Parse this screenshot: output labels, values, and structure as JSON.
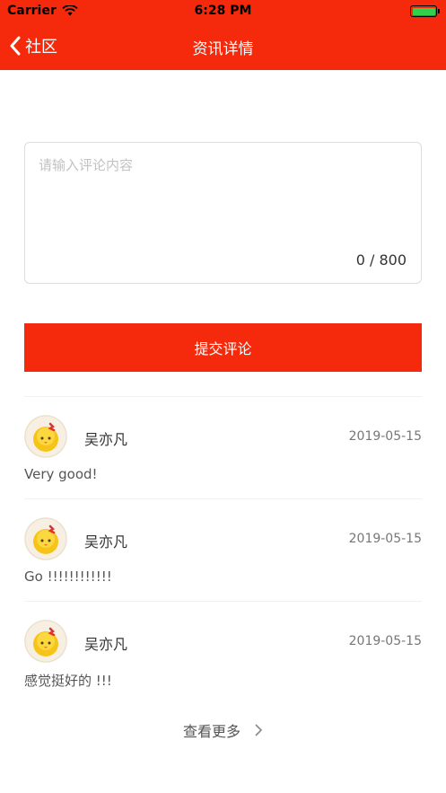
{
  "status_bar": {
    "carrier": "Carrier",
    "time": "6:28 PM",
    "wifi_icon": "wifi-icon",
    "battery_icon": "battery-icon",
    "battery_color": "#35d04a"
  },
  "nav": {
    "back_label": "社区",
    "title": "资讯详情",
    "background_color": "#f52a0c"
  },
  "comment_form": {
    "placeholder": "请输入评论内容",
    "value": "",
    "char_count": "0 / 800",
    "submit_label": "提交评论"
  },
  "comments": [
    {
      "user": "吴亦凡",
      "date": "2019-05-15",
      "text": "Very good!"
    },
    {
      "user": "吴亦凡",
      "date": "2019-05-15",
      "text": "Go !!!!!!!!!!!!"
    },
    {
      "user": "吴亦凡",
      "date": "2019-05-15",
      "text": "感觉挺好的 !!!"
    }
  ],
  "more_label": "查看更多"
}
